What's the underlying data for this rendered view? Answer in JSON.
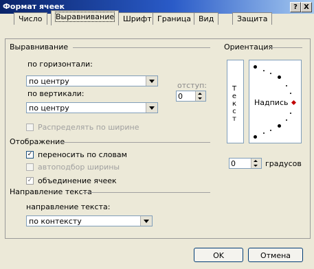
{
  "window": {
    "title": "Формат ячеек",
    "help_btn": "?",
    "close_btn": "X"
  },
  "tabs": [
    {
      "label": "Число",
      "active": false
    },
    {
      "label": "Выравнивание",
      "active": true
    },
    {
      "label": "Шрифт",
      "active": false
    },
    {
      "label": "Граница",
      "active": false
    },
    {
      "label": "Вид",
      "active": false
    },
    {
      "label": "Защита",
      "active": false
    }
  ],
  "alignment": {
    "group": "Выравнивание",
    "horizontal_label": "по горизонтали:",
    "horizontal_value": "по центру",
    "vertical_label": "по вертикали:",
    "vertical_value": "по центру",
    "indent_label": "отступ:",
    "indent_value": "0",
    "distribute_label": "Распределять по ширине"
  },
  "display": {
    "group": "Отображение",
    "wrap_label": "переносить по словам",
    "wrap_checked": true,
    "shrink_label": "автоподбор ширины",
    "shrink_checked": false,
    "merge_label": "объединение ячеек",
    "merge_checked": true
  },
  "direction": {
    "group": "Направление текста",
    "label": "направление текста:",
    "value": "по контексту"
  },
  "orientation": {
    "group": "Ориентация",
    "vertical_text": "Текст",
    "label": "Надпись",
    "degrees_value": "0",
    "degrees_label": "градусов"
  },
  "buttons": {
    "ok": "OK",
    "cancel": "Отмена"
  }
}
